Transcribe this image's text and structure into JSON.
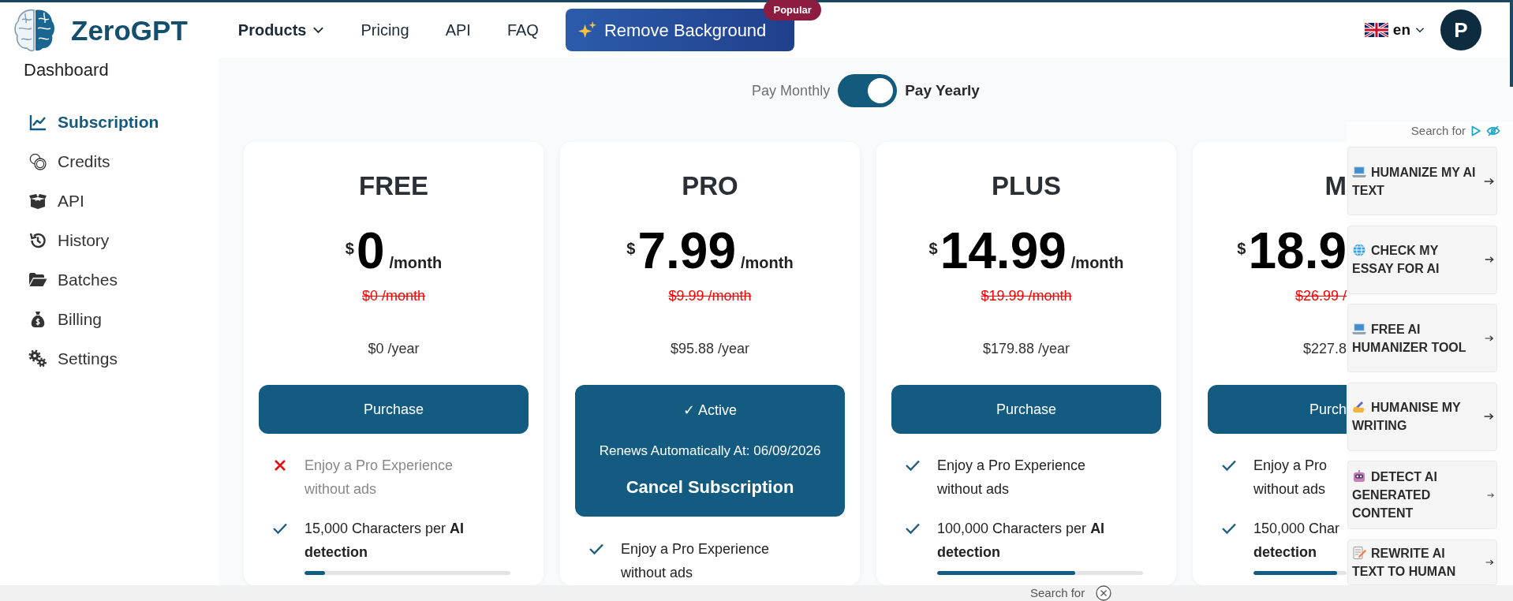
{
  "header": {
    "logo": "ZeroGPT",
    "nav": [
      {
        "label": "Products",
        "kind": "menu"
      },
      {
        "label": "Pricing",
        "kind": "link"
      },
      {
        "label": "API",
        "kind": "link"
      },
      {
        "label": "FAQ",
        "kind": "link"
      }
    ],
    "promo": {
      "label": "Remove Background",
      "badge": "Popular"
    },
    "language": "en",
    "avatar": "P"
  },
  "sidebar": {
    "title": "Dashboard",
    "items": [
      {
        "label": "Subscription",
        "kind": "chart",
        "selected": true
      },
      {
        "label": "Credits",
        "kind": "coins",
        "selected": false
      },
      {
        "label": "API",
        "kind": "box",
        "selected": false
      },
      {
        "label": "History",
        "kind": "history",
        "selected": false
      },
      {
        "label": "Batches",
        "kind": "folder",
        "selected": false
      },
      {
        "label": "Billing",
        "kind": "moneybag",
        "selected": false
      },
      {
        "label": "Settings",
        "kind": "gears",
        "selected": false
      }
    ]
  },
  "billing_toggle": {
    "on": true,
    "options": [
      {
        "label": "Pay Monthly",
        "selected": false
      },
      {
        "label": "Pay Yearly",
        "selected": true
      }
    ]
  },
  "plans": [
    {
      "name": "FREE",
      "currency": "$",
      "price": "0",
      "period": "/month",
      "old_price": "$0 /month",
      "yearly": "$0 /year",
      "action": {
        "kind": "purchase",
        "label": "Purchase"
      },
      "features": [
        {
          "text": "Enjoy a Pro Experience without ads",
          "included": false
        },
        {
          "text": "15,000 Characters per **AI detection**",
          "included": true,
          "level": 0.1
        }
      ]
    },
    {
      "name": "PRO",
      "currency": "$",
      "price": "7.99",
      "period": "/month",
      "old_price": "$9.99 /month",
      "yearly": "$95.88 /year",
      "action": {
        "kind": "active",
        "label": "✓ Active",
        "note": "Renews Automatically At: 06/09/2026",
        "cancel": "Cancel Subscription"
      },
      "features": [
        {
          "text": "Enjoy a Pro Experience without ads",
          "included": true
        }
      ]
    },
    {
      "name": "PLUS",
      "currency": "$",
      "price": "14.99",
      "period": "/month",
      "old_price": "$19.99 /month",
      "yearly": "$179.88 /year",
      "action": {
        "kind": "purchase",
        "label": "Purchase"
      },
      "features": [
        {
          "text": "Enjoy a Pro Experience without ads",
          "included": true
        },
        {
          "text": "100,000 Characters per **AI detection**",
          "included": true,
          "level": 0.67
        }
      ]
    },
    {
      "name": "M",
      "currency": "$",
      "price": "18.9",
      "old_price": "$26.99 /",
      "yearly": "$227.8",
      "action": {
        "kind": "purchase",
        "label": "Purch"
      },
      "features": [
        {
          "text": "Enjoy a Pro without ads",
          "included": true
        },
        {
          "text": "150,000 Char **detection**",
          "included": true,
          "level": 0.9
        }
      ]
    }
  ],
  "ads": {
    "label": "Search for",
    "items": [
      {
        "kind": "laptop",
        "text": "HUMANIZE MY AI TEXT"
      },
      {
        "kind": "globe",
        "text": "CHECK MY ESSAY FOR AI"
      },
      {
        "kind": "laptop",
        "text": "FREE AI HUMANIZER TOOL"
      },
      {
        "kind": "hand",
        "text": "HUMANISE MY WRITING"
      },
      {
        "kind": "robot",
        "text": "DETECT AI GENERATED CONTENT"
      },
      {
        "kind": "memo",
        "text": "REWRITE AI TEXT TO HUMAN"
      }
    ]
  },
  "bottom_bar": {
    "label": "Search for"
  }
}
